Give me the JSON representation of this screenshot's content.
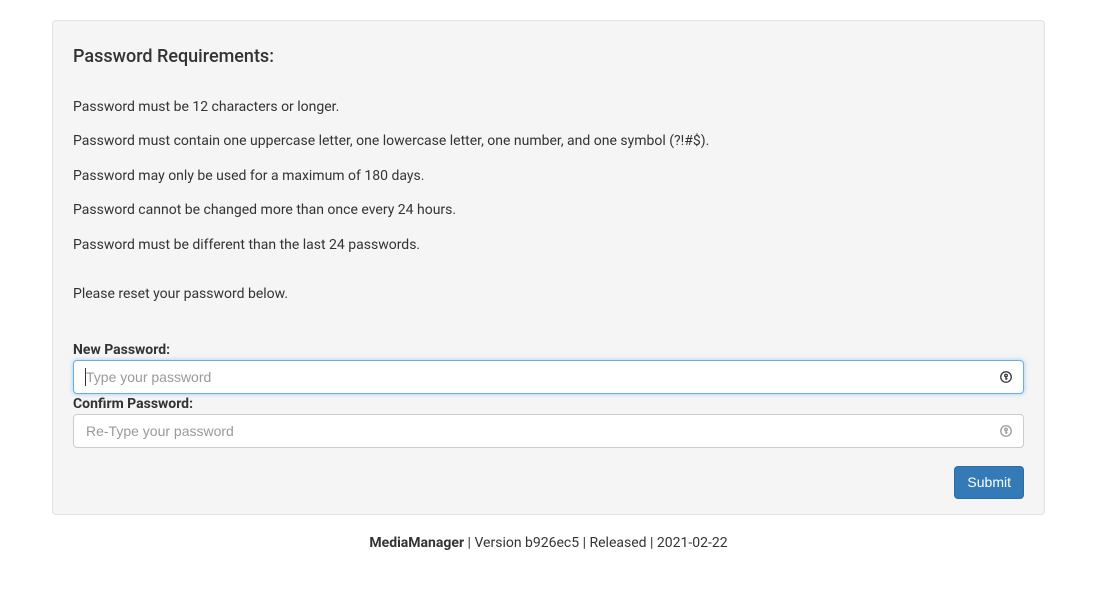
{
  "panel": {
    "heading": "Password Requirements:",
    "requirements": [
      "Password must be 12 characters or longer.",
      "Password must contain one uppercase letter, one lowercase letter, one number, and one symbol (?!#$).",
      "Password may only be used for a maximum of 180 days.",
      "Password cannot be changed more than once every 24 hours.",
      "Password must be different than the last 24 passwords."
    ],
    "instruction": "Please reset your password below."
  },
  "form": {
    "new_password_label": "New Password:",
    "new_password_placeholder": "Type your password",
    "new_password_value": "",
    "confirm_password_label": "Confirm Password:",
    "confirm_password_placeholder": "Re-Type your password",
    "confirm_password_value": "",
    "submit_label": "Submit"
  },
  "footer": {
    "app_name": "MediaManager",
    "separator1": " | Version ",
    "version": "b926ec5",
    "separator2": " | Released | ",
    "release_date": "2021-02-22"
  }
}
